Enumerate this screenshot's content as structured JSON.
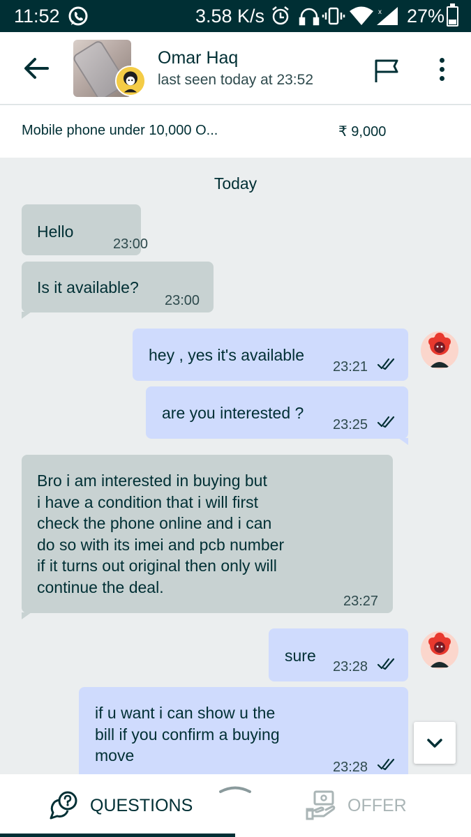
{
  "status_bar": {
    "time": "11:52",
    "network_speed": "3.58 K/s",
    "battery_percent": "27%",
    "icons": [
      "whatsapp-icon",
      "alarm-icon",
      "headset-icon",
      "vibrate-icon",
      "wifi-icon",
      "signal-icon",
      "battery-icon"
    ]
  },
  "header": {
    "contact_name": "Omar Haq",
    "last_seen": "last seen today at 23:52",
    "icons": [
      "back-arrow-icon",
      "flag-icon",
      "more-options-icon"
    ]
  },
  "ad": {
    "title": "Mobile phone under 10,000 O...",
    "price": "₹ 9,000"
  },
  "chat": {
    "date_separator": "Today",
    "messages": [
      {
        "direction": "in",
        "text": "Hello",
        "time": "23:00"
      },
      {
        "direction": "in",
        "text": "Is it available?",
        "time": "23:00"
      },
      {
        "direction": "out",
        "text": "hey , yes it's available",
        "time": "23:21",
        "read": true
      },
      {
        "direction": "out",
        "text": "are you interested ?",
        "time": "23:25",
        "read": true
      },
      {
        "direction": "in",
        "text": "Bro i am interested in buying but i have a condition that i will first check the phone online and i can do so with its imei and pcb number if it turns out original then only will continue the deal.",
        "lines": [
          "Bro i am interested in buying but",
          "i have a condition that i will first",
          "check the phone online and i can",
          "do so with its imei and pcb number",
          "if it turns out original then only will",
          "continue the deal."
        ],
        "time": "23:27"
      },
      {
        "direction": "out",
        "text": "sure",
        "time": "23:28",
        "read": true
      },
      {
        "direction": "out",
        "text": "if u want i can show u the bill if you confirm a buying move",
        "lines": [
          "if u want i can show u the",
          "bill if you confirm a buying",
          "move"
        ],
        "time": "23:28",
        "read": true
      }
    ]
  },
  "bottom_tabs": {
    "questions": "QUESTIONS",
    "offer": "OFFER",
    "active": "questions"
  },
  "colors": {
    "primary": "#002f34",
    "incoming_bubble": "#c8d2d2",
    "outgoing_bubble": "#cfdbfd",
    "chat_background": "#ebeeef",
    "inactive_tab": "#aab5b6"
  }
}
